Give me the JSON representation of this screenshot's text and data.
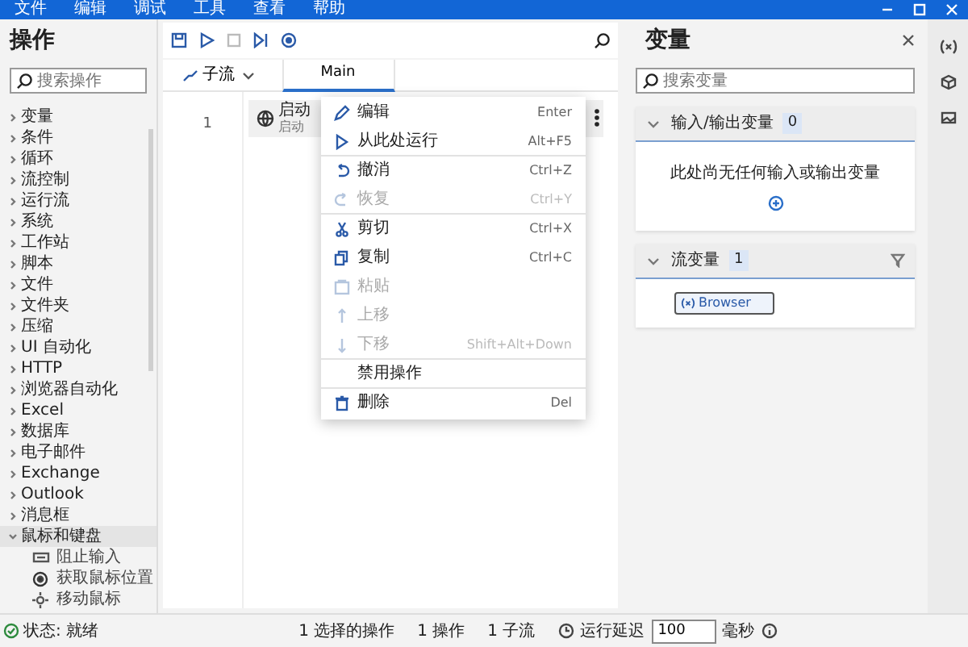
{
  "menu": [
    "文件",
    "编辑",
    "调试",
    "工具",
    "查看",
    "帮助"
  ],
  "actions_panel": {
    "title": "操作",
    "search": {
      "placeholder": "搜索操作"
    },
    "items": [
      {
        "label": "变量",
        "expanded": false,
        "selected": false
      },
      {
        "label": "条件",
        "expanded": false,
        "selected": false
      },
      {
        "label": "循环",
        "expanded": false,
        "selected": false
      },
      {
        "label": "流控制",
        "expanded": false,
        "selected": false
      },
      {
        "label": "运行流",
        "expanded": false,
        "selected": false
      },
      {
        "label": "系统",
        "expanded": false,
        "selected": false
      },
      {
        "label": "工作站",
        "expanded": false,
        "selected": false
      },
      {
        "label": "脚本",
        "expanded": false,
        "selected": false
      },
      {
        "label": "文件",
        "expanded": false,
        "selected": false
      },
      {
        "label": "文件夹",
        "expanded": false,
        "selected": false
      },
      {
        "label": "压缩",
        "expanded": false,
        "selected": false
      },
      {
        "label": "UI 自动化",
        "expanded": false,
        "selected": false
      },
      {
        "label": "HTTP",
        "expanded": false,
        "selected": false
      },
      {
        "label": "浏览器自动化",
        "expanded": false,
        "selected": false
      },
      {
        "label": "Excel",
        "expanded": false,
        "selected": false
      },
      {
        "label": "数据库",
        "expanded": false,
        "selected": false
      },
      {
        "label": "电子邮件",
        "expanded": false,
        "selected": false
      },
      {
        "label": "Exchange",
        "expanded": false,
        "selected": false
      },
      {
        "label": "Outlook",
        "expanded": false,
        "selected": false
      },
      {
        "label": "消息框",
        "expanded": false,
        "selected": false
      },
      {
        "label": "鼠标和键盘",
        "expanded": true,
        "selected": true,
        "children": [
          {
            "label": "阻止输入"
          },
          {
            "label": "获取鼠标位置"
          },
          {
            "label": "移动鼠标"
          }
        ]
      }
    ]
  },
  "subflows_button": "子流",
  "tabs": [
    {
      "label": "Main",
      "selected": true
    }
  ],
  "flow_rows": [
    {
      "number": "1",
      "title": "启动",
      "subtitle": "启动"
    }
  ],
  "context_menu": [
    {
      "label": "编辑",
      "shortcut": "Enter",
      "disabled": false,
      "separator_after": false
    },
    {
      "label": "从此处运行",
      "shortcut": "Alt+F5",
      "disabled": false,
      "separator_after": true
    },
    {
      "label": "撤消",
      "shortcut": "Ctrl+Z",
      "disabled": false,
      "separator_after": false
    },
    {
      "label": "恢复",
      "shortcut": "Ctrl+Y",
      "disabled": true,
      "separator_after": true
    },
    {
      "label": "剪切",
      "shortcut": "Ctrl+X",
      "disabled": false,
      "separator_after": false
    },
    {
      "label": "复制",
      "shortcut": "Ctrl+C",
      "disabled": false,
      "separator_after": false
    },
    {
      "label": "粘贴",
      "disabled": true,
      "separator_after": false
    },
    {
      "label": "上移",
      "disabled": true,
      "separator_after": false
    },
    {
      "label": "下移",
      "shortcut": "Shift+Alt+Down",
      "disabled": true,
      "separator_after": true
    },
    {
      "label": "禁用操作",
      "disabled": false,
      "separator_after": true
    },
    {
      "label": "删除",
      "shortcut": "Del",
      "disabled": false,
      "separator_after": false
    }
  ],
  "variables_panel": {
    "title": "变量",
    "search": {
      "placeholder": "搜索变量"
    },
    "sections": [
      {
        "title": "输入/输出变量",
        "count": "0",
        "expanded": true,
        "empty_text": "此处尚无任何输入或输出变量"
      },
      {
        "title": "流变量",
        "count": "1",
        "expanded": true,
        "variables": [
          "Browser"
        ]
      }
    ]
  },
  "status_bar": {
    "status": "状态: 就绪",
    "counts": [
      "1 选择的操作",
      "1 操作",
      "1 子流"
    ],
    "delay_label": "运行延迟",
    "delay_value": "100",
    "delay_unit": "毫秒"
  }
}
